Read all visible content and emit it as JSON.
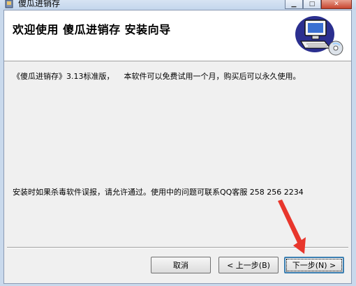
{
  "window": {
    "title": "傻瓜进销存",
    "controls": [
      "minimize",
      "maximize",
      "close"
    ]
  },
  "header": {
    "title": "欢迎使用  傻瓜进销存  安装向导",
    "graphic": "computer-setup-icon"
  },
  "body": {
    "intro": "《傻瓜进销存》3.13标准版，    本软件可以免费试用一个月，购买后可以永久使用。",
    "notice": "安装时如果杀毒软件误报，请允许通过。使用中的问题可联系QQ客服 258 256 2234"
  },
  "buttons": {
    "cancel": "取消",
    "back": "< 上一步(B)",
    "next": "下一步(N) >"
  },
  "annotation": {
    "color": "#e8362c",
    "icon": "red-arrow-icon"
  }
}
